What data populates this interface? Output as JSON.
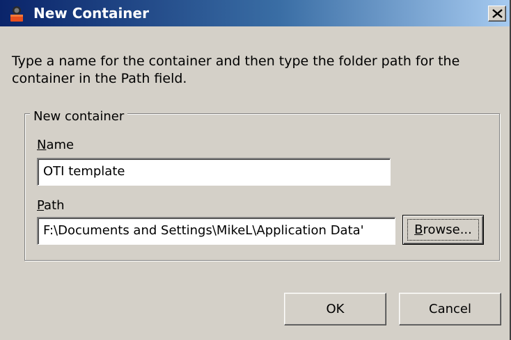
{
  "window": {
    "title": "New Container",
    "close_symbol": "X"
  },
  "instructions": "Type a name for the container and then type the folder path for the container in the Path field.",
  "group": {
    "legend": "New container",
    "name_label_accel": "N",
    "name_label_rest": "ame",
    "name_value": "OTI template",
    "path_label_accel": "P",
    "path_label_rest": "ath",
    "path_value": "F:\\Documents and Settings\\MikeL\\Application Data'",
    "browse_accel": "B",
    "browse_rest": "rowse..."
  },
  "buttons": {
    "ok": "OK",
    "cancel": "Cancel"
  },
  "icons": {
    "app": "app-icon",
    "close": "close-icon"
  }
}
